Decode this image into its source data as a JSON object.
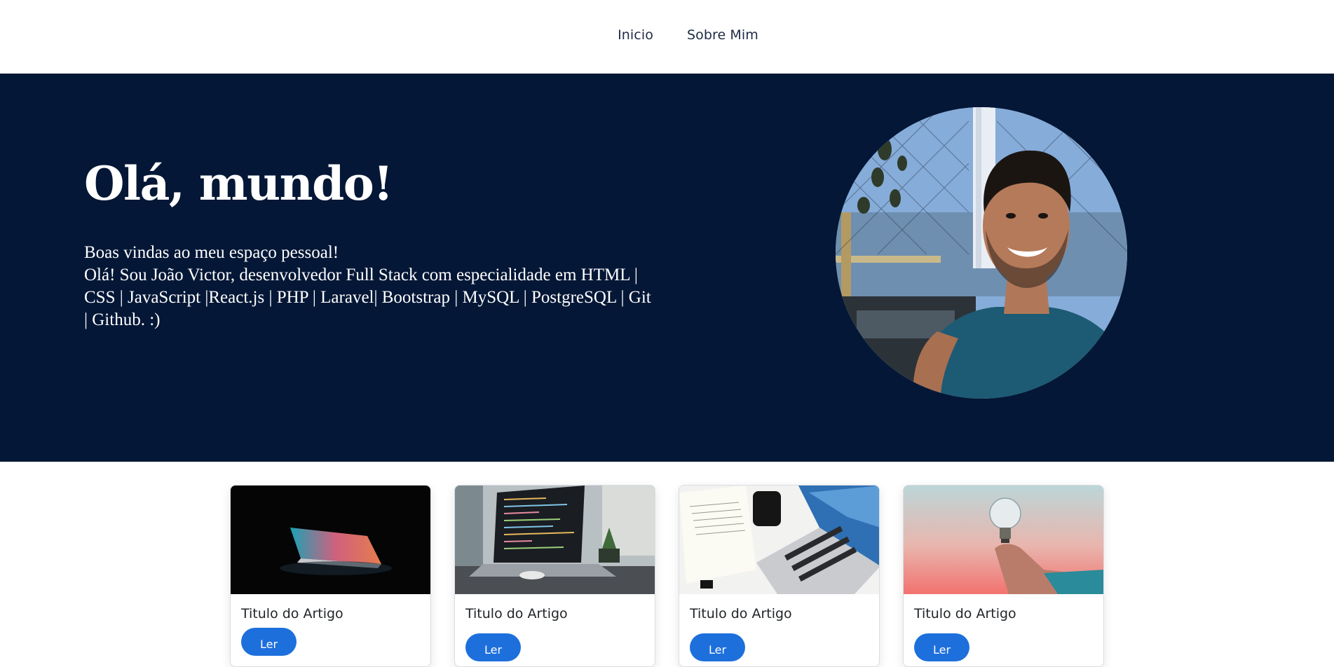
{
  "nav": {
    "items": [
      {
        "label": "Inicio"
      },
      {
        "label": "Sobre Mim"
      }
    ]
  },
  "hero": {
    "title": "Olá, mundo!",
    "lines": [
      "Boas vindas ao meu espaço pessoal!",
      "Olá! Sou João Victor, desenvolvedor Full Stack com especialidade em HTML |",
      "CSS | JavaScript |React.js | PHP | Laravel| Bootstrap | MySQL | PostgreSQL | Git",
      "| Github. :)"
    ],
    "background": "#041736"
  },
  "cards": [
    {
      "title": "Titulo do Artigo",
      "button": "Ler",
      "image": "laptop-glow-image"
    },
    {
      "title": "Titulo do Artigo",
      "button": "Ler",
      "image": "laptop-code-image"
    },
    {
      "title": "Titulo do Artigo",
      "button": "Ler",
      "image": "laptop-desk-image"
    },
    {
      "title": "Titulo do Artigo",
      "button": "Ler",
      "image": "lightbulb-hand-image"
    }
  ],
  "colors": {
    "accent": "#1d6fdc",
    "hero_bg": "#041736",
    "nav_text": "#1f2a44"
  }
}
